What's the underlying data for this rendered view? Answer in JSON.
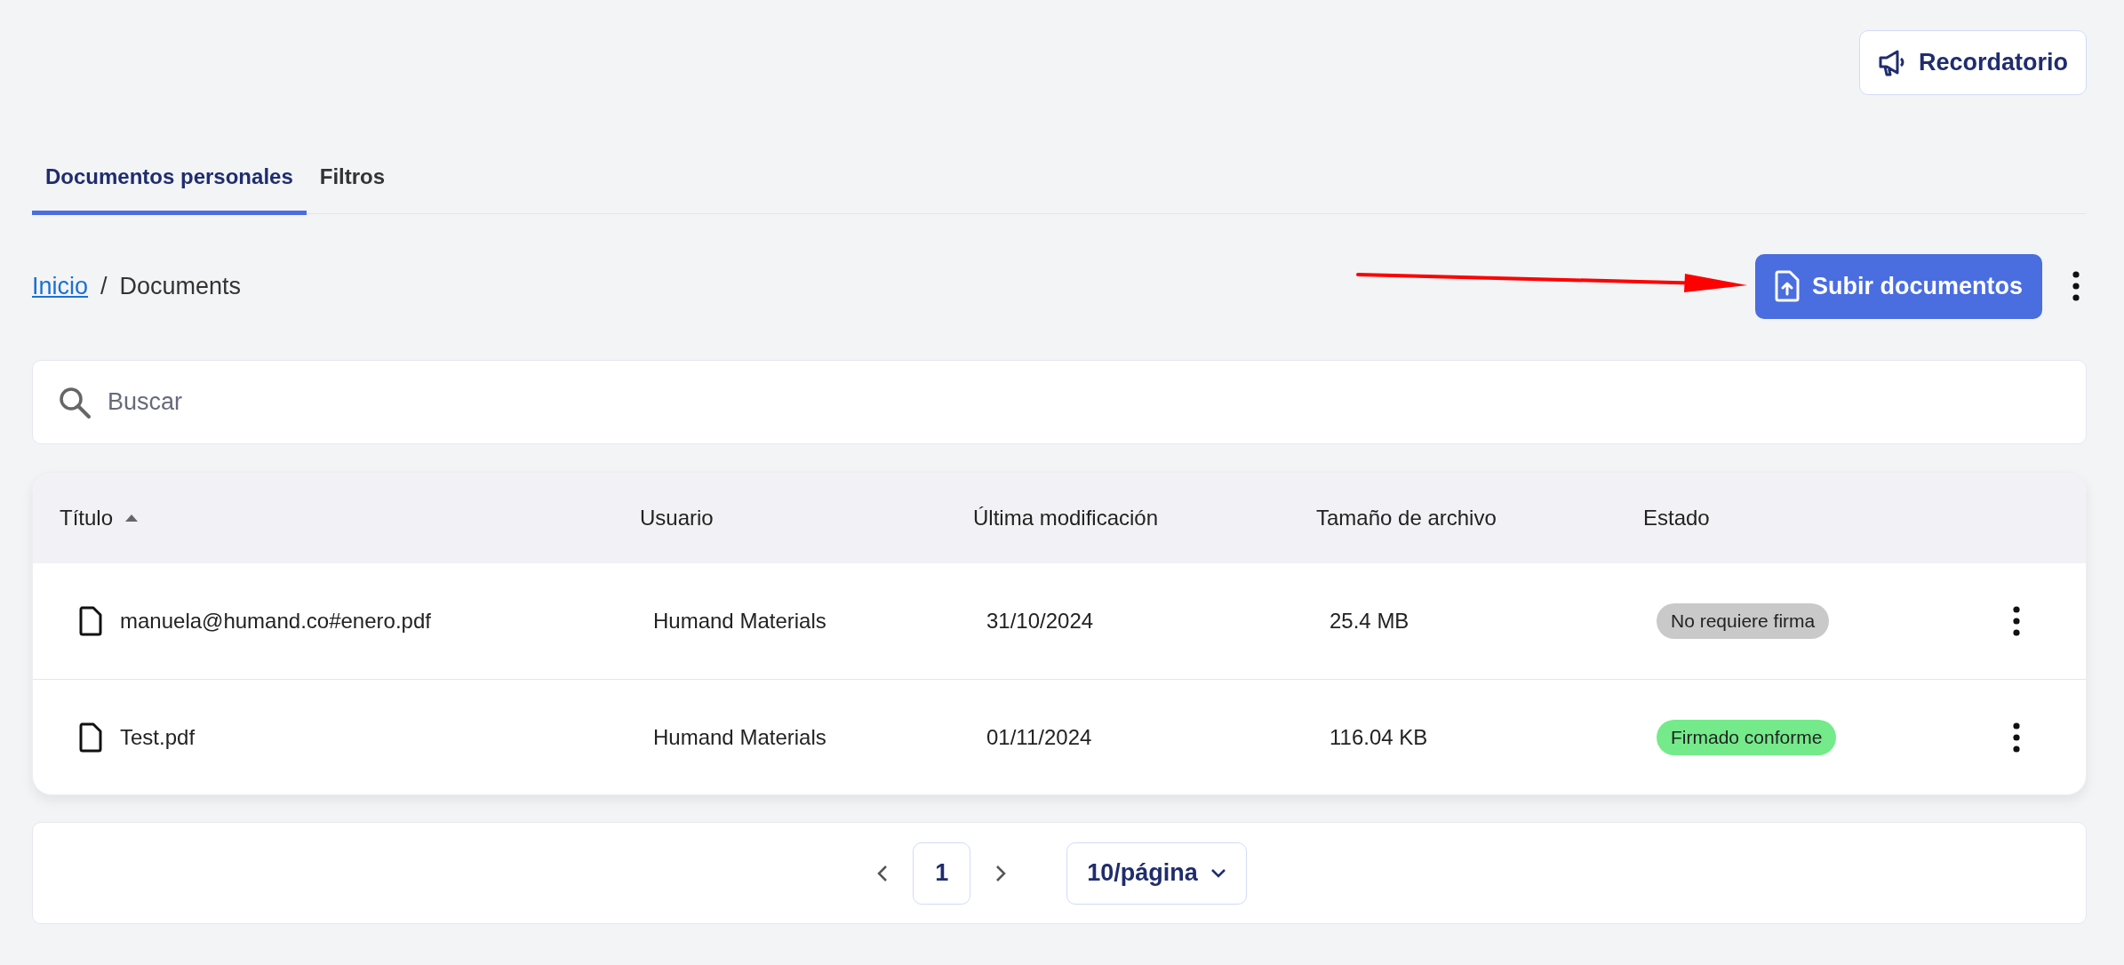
{
  "reminder_button": {
    "label": "Recordatorio"
  },
  "tabs": [
    {
      "label": "Documentos personales",
      "selected": true
    },
    {
      "label": "Filtros",
      "selected": false
    }
  ],
  "breadcrumb": [
    {
      "label": "Inicio",
      "kind": "link"
    },
    {
      "label": "Documents",
      "kind": "current"
    }
  ],
  "breadcrumb_separator": "/",
  "upload_button": {
    "label": "Subir documentos"
  },
  "search": {
    "placeholder": "Buscar"
  },
  "table": {
    "columns": [
      {
        "label": "Título",
        "sorted": true
      },
      {
        "label": "Usuario",
        "sorted": false
      },
      {
        "label": "Última modificación",
        "sorted": false
      },
      {
        "label": "Tamaño de archivo",
        "sorted": false
      },
      {
        "label": "Estado",
        "sorted": false
      }
    ],
    "rows": [
      {
        "title": "manuela@humand.co#enero.pdf",
        "user": "Humand Materials",
        "modified": "31/10/2024",
        "size": "25.4 MB",
        "status": "No requiere firma",
        "color": "#c9c9c9"
      },
      {
        "title": "Test.pdf",
        "user": "Humand Materials",
        "modified": "01/11/2024",
        "size": "116.04 KB",
        "status": "Firmado conforme",
        "color": "#74ea8a"
      }
    ]
  },
  "pagination": {
    "pages": [
      {
        "label": "1",
        "selected": true
      }
    ],
    "page_size": "10/página"
  }
}
